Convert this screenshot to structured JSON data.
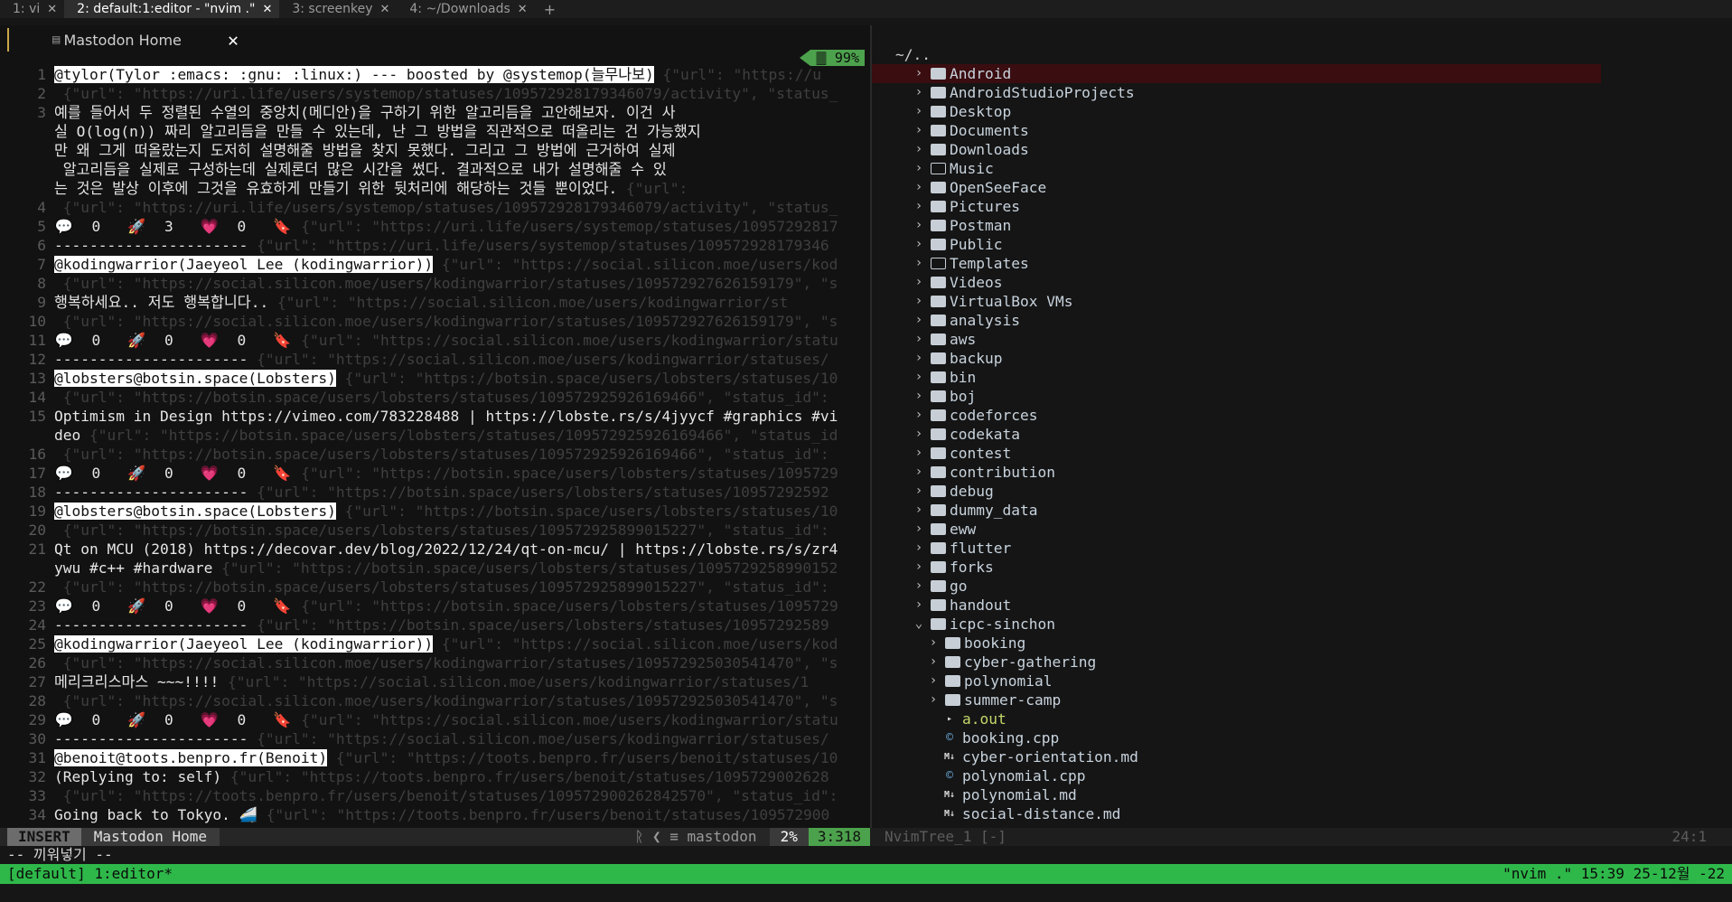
{
  "tmux": {
    "tabs": [
      {
        "label": "1: vi",
        "active": false
      },
      {
        "label": "2: default:1:editor - \"nvim .\"",
        "active": true
      },
      {
        "label": "3: screenkey",
        "active": false
      },
      {
        "label": "4: ~/Downloads",
        "active": false
      }
    ],
    "plus": "+",
    "close_glyph": "✕",
    "status_left": "[default] 1:editor*",
    "status_right": "\"nvim .\" 15:39 25-12월 -22"
  },
  "buffer_tab": {
    "name": "Mastodon Home",
    "close": "✕"
  },
  "scroll_indicator": "🀫 99%",
  "lines": [
    {
      "num": "1",
      "hdr": "@tylor(Tylor :emacs: :gnu: :linux:) --- boosted by @systemop(늘무나보)",
      "dim": " {\"url\": \"https://u"
    },
    {
      "num": "2",
      "dim": " {\"url\": \"https://uri.life/users/systemop/statuses/109572928179346079/activity\", \"status_"
    },
    {
      "num": "3",
      "txt": "예를 들어서 두 정렬된 수열의 중앙치(메디안)을 구하기 위한 알고리듬을 고안해보자. 이건 사"
    },
    {
      "num": "",
      "txt": "실 O(log(n)) 짜리 알고리듬을 만들 수 있는데, 난 그 방법을 직관적으로 떠올리는 건 가능했지"
    },
    {
      "num": "",
      "txt": "만 왜 그게 떠올랐는지 도저히 설명해줄 방법을 찾지 못했다. 그리고 그 방법에 근거하여 실제"
    },
    {
      "num": "",
      "txt": " 알고리듬을 실제로 구성하는데 실제론더 많은 시간을 썼다. 결과적으로 내가 설명해줄 수 있"
    },
    {
      "num": "",
      "txt": "는 것은 발상 이후에 그것을 유효하게 만들기 위한 뒷처리에 해당하는 것들 뿐이었다.",
      "dim": " {\"url\":"
    },
    {
      "num": "4",
      "dim": " {\"url\": \"https://uri.life/users/systemop/statuses/109572928179346079/activity\", \"status_"
    },
    {
      "num": "5",
      "stats": [
        "0",
        "3",
        "0"
      ],
      "dim": " {\"url\": \"https://uri.life/users/systemop/statuses/10957292817"
    },
    {
      "num": "6",
      "txt": "----------------------",
      "dim": " {\"url\": \"https://uri.life/users/systemop/statuses/109572928179346"
    },
    {
      "num": "7",
      "hdr": "@kodingwarrior(Jaeyeol Lee (kodingwarrior))",
      "dim": " {\"url\": \"https://social.silicon.moe/users/kod"
    },
    {
      "num": "8",
      "dim": " {\"url\": \"https://social.silicon.moe/users/kodingwarrior/statuses/109572927626159179\", \"s"
    },
    {
      "num": "9",
      "txt": "행복하세요.. 저도 행복합니다..",
      "dim": " {\"url\": \"https://social.silicon.moe/users/kodingwarrior/st"
    },
    {
      "num": "10",
      "dim": " {\"url\": \"https://social.silicon.moe/users/kodingwarrior/statuses/109572927626159179\", \"s"
    },
    {
      "num": "11",
      "stats": [
        "0",
        "0",
        "0"
      ],
      "dim": " {\"url\": \"https://social.silicon.moe/users/kodingwarrior/statu"
    },
    {
      "num": "12",
      "txt": "----------------------",
      "dim": " {\"url\": \"https://social.silicon.moe/users/kodingwarrior/statuses/"
    },
    {
      "num": "13",
      "hdr": "@lobsters@botsin.space(Lobsters)",
      "dim": " {\"url\": \"https://botsin.space/users/lobsters/statuses/10"
    },
    {
      "num": "14",
      "dim": " {\"url\": \"https://botsin.space/users/lobsters/statuses/109572925926169466\", \"status_id\":"
    },
    {
      "num": "15",
      "txt": "Optimism in Design https://vimeo.com/783228488 | https://lobste.rs/s/4jyycf #graphics #vi"
    },
    {
      "num": "",
      "txt": "deo",
      "dim": " {\"url\": \"https://botsin.space/users/lobsters/statuses/109572925926169466\", \"status_id"
    },
    {
      "num": "16",
      "dim": " {\"url\": \"https://botsin.space/users/lobsters/statuses/109572925926169466\", \"status_id\":"
    },
    {
      "num": "17",
      "stats": [
        "0",
        "0",
        "0"
      ],
      "dim": " {\"url\": \"https://botsin.space/users/lobsters/statuses/1095729"
    },
    {
      "num": "18",
      "txt": "----------------------",
      "dim": " {\"url\": \"https://botsin.space/users/lobsters/statuses/10957292592"
    },
    {
      "num": "19",
      "hdr": "@lobsters@botsin.space(Lobsters)",
      "dim": " {\"url\": \"https://botsin.space/users/lobsters/statuses/10"
    },
    {
      "num": "20",
      "dim": " {\"url\": \"https://botsin.space/users/lobsters/statuses/109572925899015227\", \"status_id\":"
    },
    {
      "num": "21",
      "txt": "Qt on MCU (2018) https://decovar.dev/blog/2022/12/24/qt-on-mcu/ | https://lobste.rs/s/zr4"
    },
    {
      "num": "",
      "txt": "ywu #c++ #hardware",
      "dim": " {\"url\": \"https://botsin.space/users/lobsters/statuses/1095729258990152"
    },
    {
      "num": "22",
      "dim": " {\"url\": \"https://botsin.space/users/lobsters/statuses/109572925899015227\", \"status_id\":"
    },
    {
      "num": "23",
      "stats": [
        "0",
        "0",
        "0"
      ],
      "dim": " {\"url\": \"https://botsin.space/users/lobsters/statuses/1095729"
    },
    {
      "num": "24",
      "txt": "----------------------",
      "dim": " {\"url\": \"https://botsin.space/users/lobsters/statuses/10957292589"
    },
    {
      "num": "25",
      "hdr": "@kodingwarrior(Jaeyeol Lee (kodingwarrior))",
      "dim": " {\"url\": \"https://social.silicon.moe/users/kod"
    },
    {
      "num": "26",
      "dim": " {\"url\": \"https://social.silicon.moe/users/kodingwarrior/statuses/109572925030541470\", \"s"
    },
    {
      "num": "27",
      "txt": "메리크리스마스 ~~~!!!!",
      "dim": " {\"url\": \"https://social.silicon.moe/users/kodingwarrior/statuses/1"
    },
    {
      "num": "28",
      "dim": " {\"url\": \"https://social.silicon.moe/users/kodingwarrior/statuses/109572925030541470\", \"s"
    },
    {
      "num": "29",
      "stats": [
        "0",
        "0",
        "0"
      ],
      "dim": " {\"url\": \"https://social.silicon.moe/users/kodingwarrior/statu"
    },
    {
      "num": "30",
      "txt": "----------------------",
      "dim": " {\"url\": \"https://social.silicon.moe/users/kodingwarrior/statuses/"
    },
    {
      "num": "31",
      "hdr": "@benoit@toots.benpro.fr(Benoit)",
      "dim": " {\"url\": \"https://toots.benpro.fr/users/benoit/statuses/10"
    },
    {
      "num": "32",
      "txt": "(Replying to: self)",
      "dim": " {\"url\": \"https://toots.benpro.fr/users/benoit/statuses/1095729002628"
    },
    {
      "num": "33",
      "dim": " {\"url\": \"https://toots.benpro.fr/users/benoit/statuses/109572900262842570\", \"status_id\":"
    },
    {
      "num": "34",
      "txt": "Going back to Tokyo. 🚄",
      "dim": " {\"url\": \"https://toots.benpro.fr/users/benoit/statuses/109572900"
    }
  ],
  "stat_icons": [
    "💬",
    "🚀",
    "💗",
    "🔖"
  ],
  "tree": {
    "root": "~/..",
    "items": [
      {
        "type": "dir",
        "name": "Android",
        "depth": 0,
        "selected": true
      },
      {
        "type": "dir",
        "name": "AndroidStudioProjects",
        "depth": 0
      },
      {
        "type": "dir",
        "name": "Desktop",
        "depth": 0
      },
      {
        "type": "dir",
        "name": "Documents",
        "depth": 0
      },
      {
        "type": "dir",
        "name": "Downloads",
        "depth": 0
      },
      {
        "type": "dir-empty",
        "name": "Music",
        "depth": 0
      },
      {
        "type": "dir",
        "name": "OpenSeeFace",
        "depth": 0
      },
      {
        "type": "dir",
        "name": "Pictures",
        "depth": 0
      },
      {
        "type": "dir",
        "name": "Postman",
        "depth": 0
      },
      {
        "type": "dir",
        "name": "Public",
        "depth": 0
      },
      {
        "type": "dir-empty",
        "name": "Templates",
        "depth": 0
      },
      {
        "type": "dir",
        "name": "Videos",
        "depth": 0
      },
      {
        "type": "dir",
        "name": "VirtualBox VMs",
        "depth": 0
      },
      {
        "type": "dir",
        "name": "analysis",
        "depth": 0
      },
      {
        "type": "dir",
        "name": "aws",
        "depth": 0
      },
      {
        "type": "dir",
        "name": "backup",
        "depth": 0
      },
      {
        "type": "dir",
        "name": "bin",
        "depth": 0
      },
      {
        "type": "dir",
        "name": "boj",
        "depth": 0
      },
      {
        "type": "dir",
        "name": "codeforces",
        "depth": 0
      },
      {
        "type": "dir",
        "name": "codekata",
        "depth": 0
      },
      {
        "type": "dir",
        "name": "contest",
        "depth": 0
      },
      {
        "type": "dir",
        "name": "contribution",
        "depth": 0
      },
      {
        "type": "dir",
        "name": "debug",
        "depth": 0
      },
      {
        "type": "dir",
        "name": "dummy_data",
        "depth": 0
      },
      {
        "type": "dir",
        "name": "eww",
        "depth": 0
      },
      {
        "type": "dir",
        "name": "flutter",
        "depth": 0
      },
      {
        "type": "dir",
        "name": "forks",
        "depth": 0
      },
      {
        "type": "dir",
        "name": "go",
        "depth": 0
      },
      {
        "type": "dir",
        "name": "handout",
        "depth": 0
      },
      {
        "type": "dir-open",
        "name": "icpc-sinchon",
        "depth": 0
      },
      {
        "type": "dir",
        "name": "booking",
        "depth": 1
      },
      {
        "type": "dir",
        "name": "cyber-gathering",
        "depth": 1
      },
      {
        "type": "dir",
        "name": "polynomial",
        "depth": 1
      },
      {
        "type": "dir",
        "name": "summer-camp",
        "depth": 1
      },
      {
        "type": "exec",
        "name": "a.out",
        "depth": 1
      },
      {
        "type": "cpp",
        "name": "booking.cpp",
        "depth": 1
      },
      {
        "type": "md",
        "name": "cyber-orientation.md",
        "depth": 1
      },
      {
        "type": "cpp",
        "name": "polynomial.cpp",
        "depth": 1
      },
      {
        "type": "md",
        "name": "polynomial.md",
        "depth": 1
      },
      {
        "type": "md",
        "name": "social-distance.md",
        "depth": 1
      }
    ]
  },
  "statusline": {
    "mode": "INSERT",
    "buffer": "Mastodon Home",
    "branch": "ᚱ ❮ ≡ mastodon",
    "percent": "2%",
    "position": "3:318"
  },
  "tree_status": {
    "name": "NvimTree_1 [-]",
    "position": "24:1"
  },
  "cmdline": "-- 끼워넣기 --",
  "colors": {
    "tmux_status_bg": "#2fb84a",
    "accent_green": "#4ca24c",
    "selected_row": "#3a0d10"
  }
}
